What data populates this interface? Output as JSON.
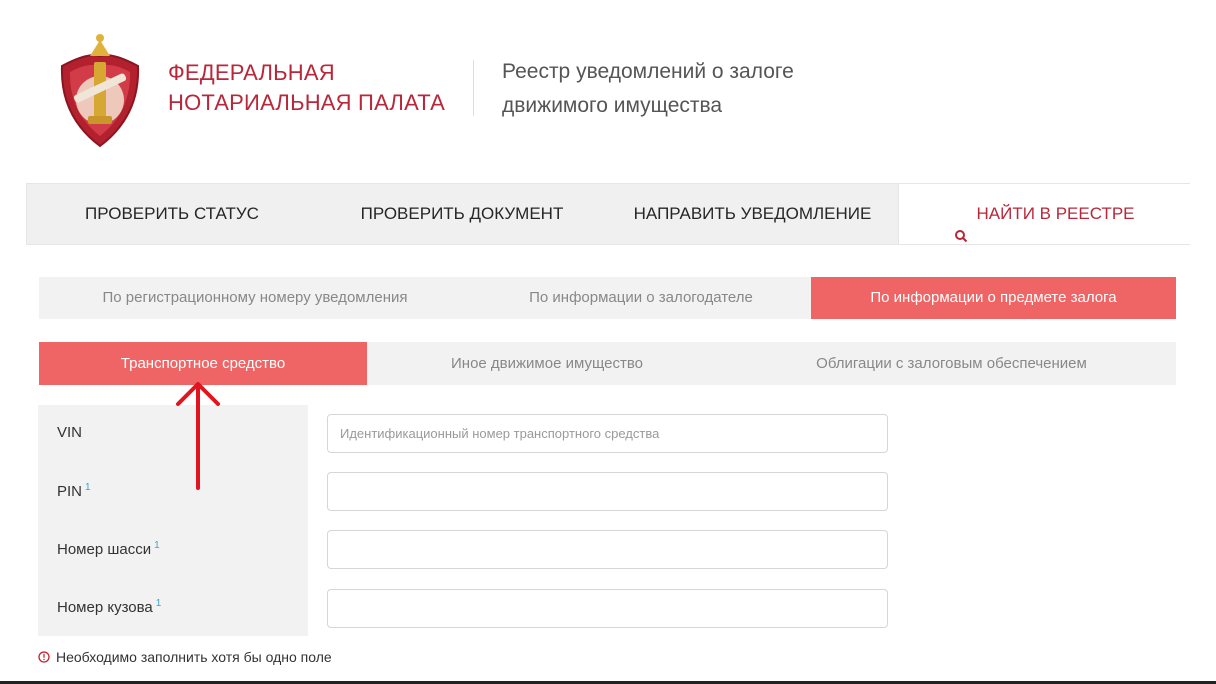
{
  "header": {
    "org_name_line1": "ФЕДЕРАЛЬНАЯ",
    "org_name_line2": "НОТАРИАЛЬНАЯ ПАЛАТА",
    "registry_title_line1": "Реестр уведомлений о залоге",
    "registry_title_line2": "движимого имущества"
  },
  "nav": {
    "items": [
      {
        "label": "ПРОВЕРИТЬ СТАТУС"
      },
      {
        "label": "ПРОВЕРИТЬ ДОКУМЕНТ"
      },
      {
        "label": "НАПРАВИТЬ УВЕДОМЛЕНИЕ"
      },
      {
        "label": "НАЙТИ В РЕЕСТРЕ",
        "icon": "search-icon",
        "active": true
      }
    ]
  },
  "search_tabs": [
    {
      "label": "По регистрационному номеру уведомления"
    },
    {
      "label": "По информации о залогодателе"
    },
    {
      "label": "По информации о предмете залога",
      "active": true
    }
  ],
  "object_tabs": [
    {
      "label": "Транспортное средство",
      "active": true
    },
    {
      "label": "Иное движимое имущество"
    },
    {
      "label": "Облигации с залоговым обеспечением"
    }
  ],
  "form": {
    "fields": [
      {
        "label": "VIN",
        "footnote": "",
        "value": "",
        "placeholder": "Идентификационный номер транспортного средства"
      },
      {
        "label": "PIN",
        "footnote": "1",
        "value": "",
        "placeholder": ""
      },
      {
        "label": "Номер шасси",
        "footnote": "1",
        "value": "",
        "placeholder": ""
      },
      {
        "label": "Номер кузова",
        "footnote": "1",
        "value": "",
        "placeholder": ""
      }
    ],
    "note": "Необходимо заполнить хотя бы одно поле"
  },
  "colors": {
    "brand_red": "#b8273a",
    "accent_coral": "#ef6565",
    "tab_bg": "#f2f2f2",
    "arrow_red": "#e0151f",
    "footnote_blue": "#3aa3c9"
  }
}
